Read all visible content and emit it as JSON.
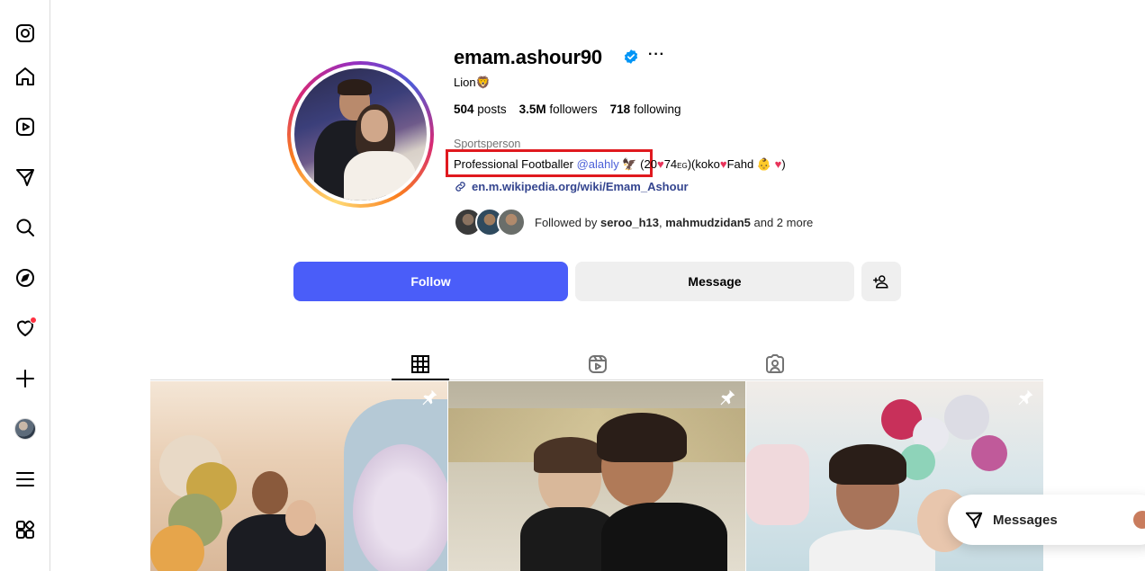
{
  "sidebar": {
    "items": [
      {
        "name": "instagram-logo-icon"
      },
      {
        "name": "home-icon"
      },
      {
        "name": "reels-icon"
      },
      {
        "name": "direct-icon"
      },
      {
        "name": "search-icon"
      },
      {
        "name": "explore-icon"
      },
      {
        "name": "notifications-heart-icon",
        "has_badge": true
      },
      {
        "name": "create-plus-icon"
      },
      {
        "name": "profile-avatar"
      },
      {
        "name": "menu-icon"
      },
      {
        "name": "more-apps-icon"
      }
    ]
  },
  "profile": {
    "username": "emam.ashour90",
    "verified": true,
    "more": "···",
    "subtitle": "Lion🦁",
    "stats": {
      "posts_count": "504",
      "posts_label": "posts",
      "followers_count": "3.5M",
      "followers_label": "followers",
      "following_count": "718",
      "following_label": "following"
    },
    "category": "Sportsperson",
    "bio": {
      "prefix": "Professional Footballer ",
      "mention": "@alahly",
      "suffix_emoji": "🦅",
      "rest_1": " (20",
      "rest_2": "74",
      "rest_small": "EG",
      "rest_3": ")(koko",
      "rest_4": "Fahd",
      "rest_5": "👶",
      "rest_6": ")"
    },
    "link": "en.m.wikipedia.org/wiki/Emam_Ashour",
    "followed_by": {
      "prefix": "Followed by ",
      "user1": "seroo_h13",
      "sep": ", ",
      "user2": "mahmudzidan5",
      "suffix": " and 2 more"
    }
  },
  "actions": {
    "follow_label": "Follow",
    "message_label": "Message"
  },
  "tabs": [
    {
      "name": "posts-grid-icon",
      "active": true
    },
    {
      "name": "reels-tab-icon",
      "active": false
    },
    {
      "name": "tagged-tab-icon",
      "active": false
    }
  ],
  "posts": [
    {
      "pinned": true
    },
    {
      "pinned": true
    },
    {
      "pinned": true
    }
  ],
  "messages": {
    "label": "Messages"
  },
  "colors": {
    "follow_button": "#4a5df9",
    "link": "#34458f",
    "mention": "#4a5fd8",
    "highlight_box": "#e0191f",
    "verified": "#0095f6",
    "notification_dot": "#ff3040"
  }
}
